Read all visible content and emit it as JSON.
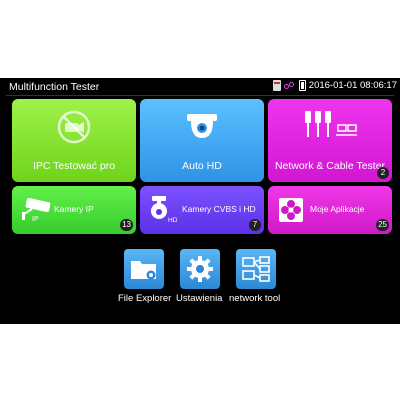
{
  "status": {
    "title": "Multifunction Tester",
    "datetime": "2016-01-01 08:06:17"
  },
  "tiles": {
    "ipc": {
      "label": "IPC Testować pro"
    },
    "ahd": {
      "label": "Auto HD"
    },
    "net": {
      "label": "Network & Cable Tester",
      "badge": "2"
    },
    "kamery_ip": {
      "label": "Kamery IP",
      "badge": "13"
    },
    "cvbs": {
      "label": "Kamery CVBS i HD",
      "badge": "7"
    },
    "apps": {
      "label": "Moje Aplikacje",
      "badge": "25"
    }
  },
  "dock": {
    "file_explorer": "File Explorer",
    "settings": "Ustawienia",
    "network_tool": "network tool"
  },
  "colors": {
    "ipc": "#8be635",
    "ahd": "#46aaf5",
    "net": "#e025e0",
    "kamery_ip": "#4cde3a",
    "cvbs": "#6a40f2",
    "apps": "#df28d8",
    "dock_icon": "#3fa0e8"
  },
  "icons": {
    "ipc": "no-camera-icon",
    "ahd": "dome-camera-icon",
    "net": "cable-connectors-icon",
    "kamery_ip": "bullet-camera-icon",
    "cvbs": "ptz-camera-icon",
    "apps": "apps-flower-icon",
    "file_explorer": "folder-gear-icon",
    "settings": "gear-icon",
    "network_tool": "network-diagram-icon"
  }
}
